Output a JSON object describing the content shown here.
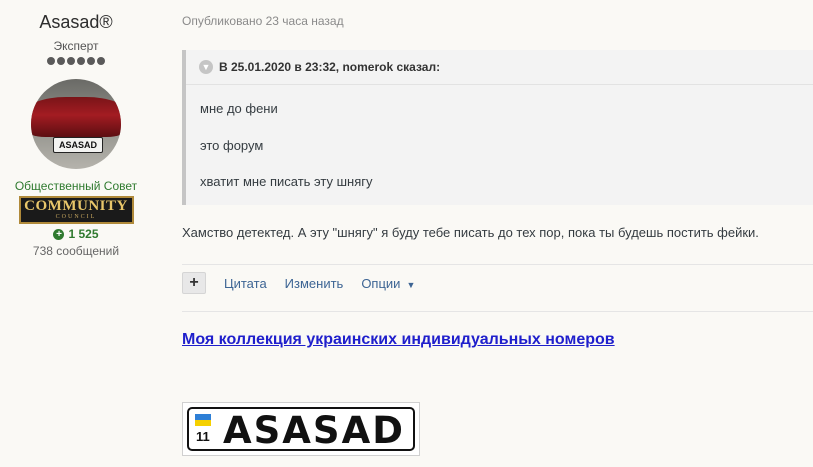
{
  "author": {
    "name": "Asasad®",
    "rank": "Эксперт",
    "rank_pips": 6,
    "avatar_plate": "ASASAD",
    "group": "Общественный Совет",
    "badge": {
      "main": "COMMUNITY",
      "sub": "COUNCIL"
    },
    "reputation": "1 525",
    "posts": "738 сообщений"
  },
  "post": {
    "meta": "Опубликовано 23 часа назад",
    "quote": {
      "header": "В 25.01.2020 в 23:32, nomerok сказал:",
      "lines": [
        "мне до фени",
        "это форум",
        "хватит мне писать эту шнягу"
      ]
    },
    "body": "Хамство детектед. А эту \"шнягу\" я буду тебе писать до тех пор, пока ты будешь постить фейки.",
    "actions": {
      "plus": "+",
      "quote": "Цитата",
      "edit": "Изменить",
      "options": "Опции"
    }
  },
  "signature": {
    "link": "Моя коллекция украинских индивидуальных номеров",
    "plate": {
      "region": "11",
      "text": "ASASAD"
    }
  },
  "colors": {
    "accent_link": "#3d6594",
    "group_green": "#2f7a2f",
    "sig_link": "#1f1fcc"
  }
}
